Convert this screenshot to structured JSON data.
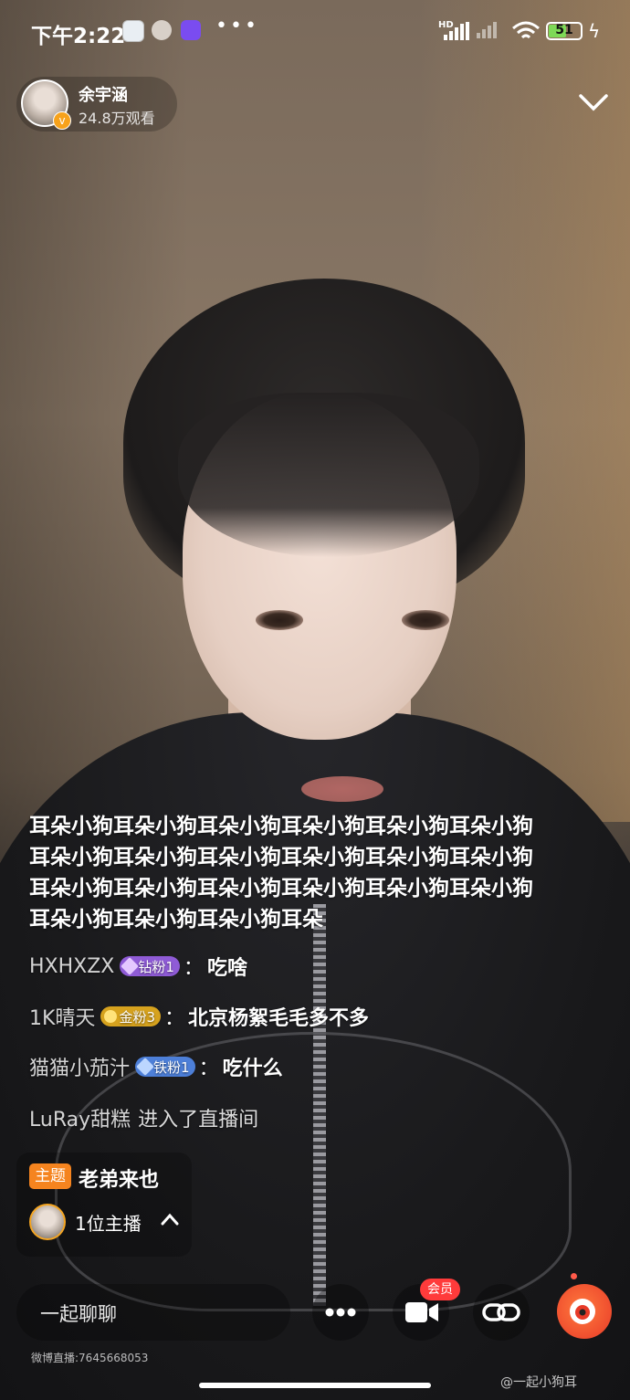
{
  "status_bar": {
    "time": "下午2:22",
    "more": "•••",
    "network": "HD",
    "battery": "51"
  },
  "host": {
    "name": "余宇涵",
    "viewers": "24.8万观看"
  },
  "chat": {
    "highlight": "耳朵小狗耳朵小狗耳朵小狗耳朵小狗耳朵小狗耳朵小狗耳朵小狗耳朵小狗耳朵小狗耳朵小狗耳朵小狗耳朵小狗耳朵小狗耳朵小狗耳朵小狗耳朵小狗耳朵小狗耳朵小狗耳朵小狗耳朵小狗耳朵小狗耳朵",
    "messages": [
      {
        "user": "HXHXZX",
        "badge": "钻粉1",
        "badge_color": "#8f5bd6",
        "text": "吃啥"
      },
      {
        "user": "1K晴天",
        "badge": "金粉3",
        "badge_color": "#d6a21e",
        "text": "北京杨絮毛毛多不多"
      },
      {
        "user": "猫猫小茄汁",
        "badge": "铁粉1",
        "badge_color": "#4d7fd8",
        "text": "吃什么"
      }
    ],
    "system_user": "LuRay甜糕",
    "system_text": "进入了直播间",
    "separator": "："
  },
  "topic": {
    "tag": "主题",
    "text": "老弟来也",
    "hosts": "1位主播"
  },
  "bottom": {
    "chat_placeholder": "一起聊聊",
    "vip_label": "会员",
    "room_id": "微博直播:7645668053"
  },
  "watermark": "@一起小狗耳",
  "colors": {
    "accent": "#f5841f",
    "vip": "#ff3b3b",
    "weibo": "#e83a28"
  }
}
